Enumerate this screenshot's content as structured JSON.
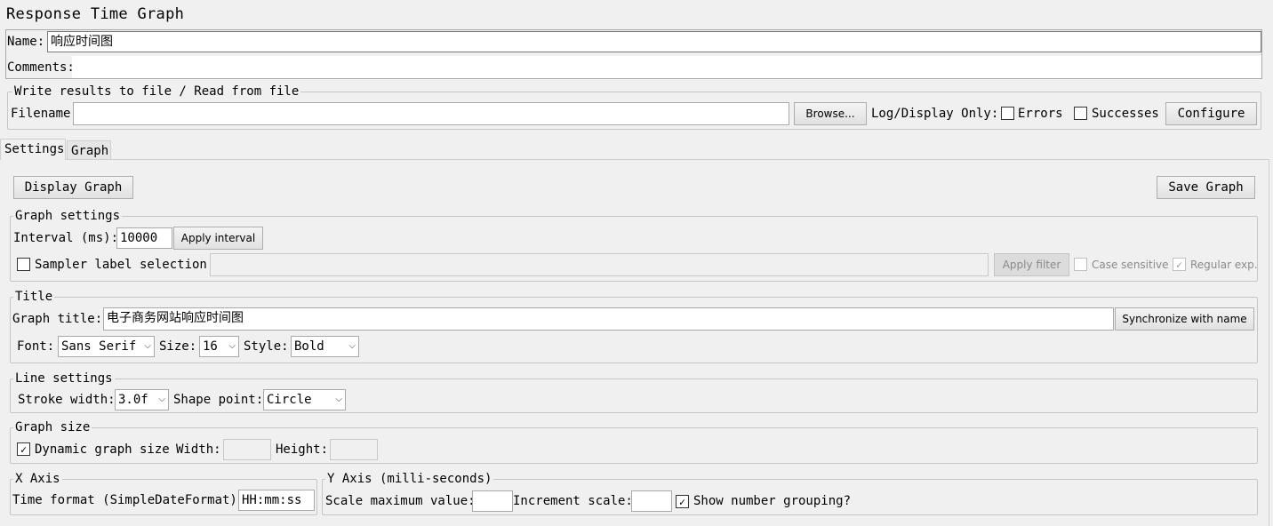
{
  "panel": {
    "title": "Response Time Graph"
  },
  "name_field": {
    "label": "Name:",
    "value": "响应时间图"
  },
  "comments_field": {
    "label": "Comments:",
    "value": ""
  },
  "file_section": {
    "legend": "Write results to file / Read from file",
    "filename_label": "Filename",
    "filename_value": "",
    "browse_label": "Browse...",
    "log_display_label": "Log/Display Only:",
    "errors_label": "Errors",
    "errors_checked": false,
    "successes_label": "Successes",
    "successes_checked": false,
    "configure_label": "Configure"
  },
  "tabs": [
    {
      "label": "Settings",
      "active": true
    },
    {
      "label": "Graph",
      "active": false
    }
  ],
  "toolbar": {
    "display_graph_label": "Display Graph",
    "save_graph_label": "Save Graph"
  },
  "graph_settings": {
    "legend": "Graph settings",
    "interval_label": "Interval (ms):",
    "interval_value": "10000",
    "apply_interval_label": "Apply interval",
    "sampler_label": "Sampler label selection:",
    "sampler_checked": false,
    "sampler_value": "",
    "apply_filter_label": "Apply filter",
    "case_sensitive_label": "Case sensitive",
    "case_sensitive_check": "",
    "regular_exp_label": "Regular exp.",
    "regular_exp_check": "✓"
  },
  "title_section": {
    "legend": "Title",
    "graph_title_label": "Graph title:",
    "graph_title_value": "电子商务网站响应时间图",
    "sync_label": "Synchronize with name",
    "font_label": "Font:",
    "font_value": "Sans Serif",
    "size_label": "Size:",
    "size_value": "16",
    "style_label": "Style:",
    "style_value": "Bold"
  },
  "line_settings": {
    "legend": "Line settings",
    "stroke_label": "Stroke width:",
    "stroke_value": "3.0f",
    "shape_label": "Shape point:",
    "shape_value": "Circle"
  },
  "graph_size": {
    "legend": "Graph size",
    "dynamic_label": "Dynamic graph size",
    "dynamic_check": "✓",
    "width_label": "Width:",
    "width_value": "",
    "height_label": "Height:",
    "height_value": ""
  },
  "x_axis": {
    "legend": "X Axis",
    "time_format_label": "Time format (SimpleDateFormat):",
    "time_format_value": "HH:mm:ss"
  },
  "y_axis": {
    "legend": "Y Axis (milli-seconds)",
    "scale_max_label": "Scale maximum value:",
    "scale_max_value": "",
    "increment_label": "Increment scale:",
    "increment_value": "",
    "grouping_label": "Show number grouping?",
    "grouping_check": "✓"
  },
  "icons": {
    "checkmark": "check-icon",
    "dropdown": "chevron-down-icon"
  }
}
